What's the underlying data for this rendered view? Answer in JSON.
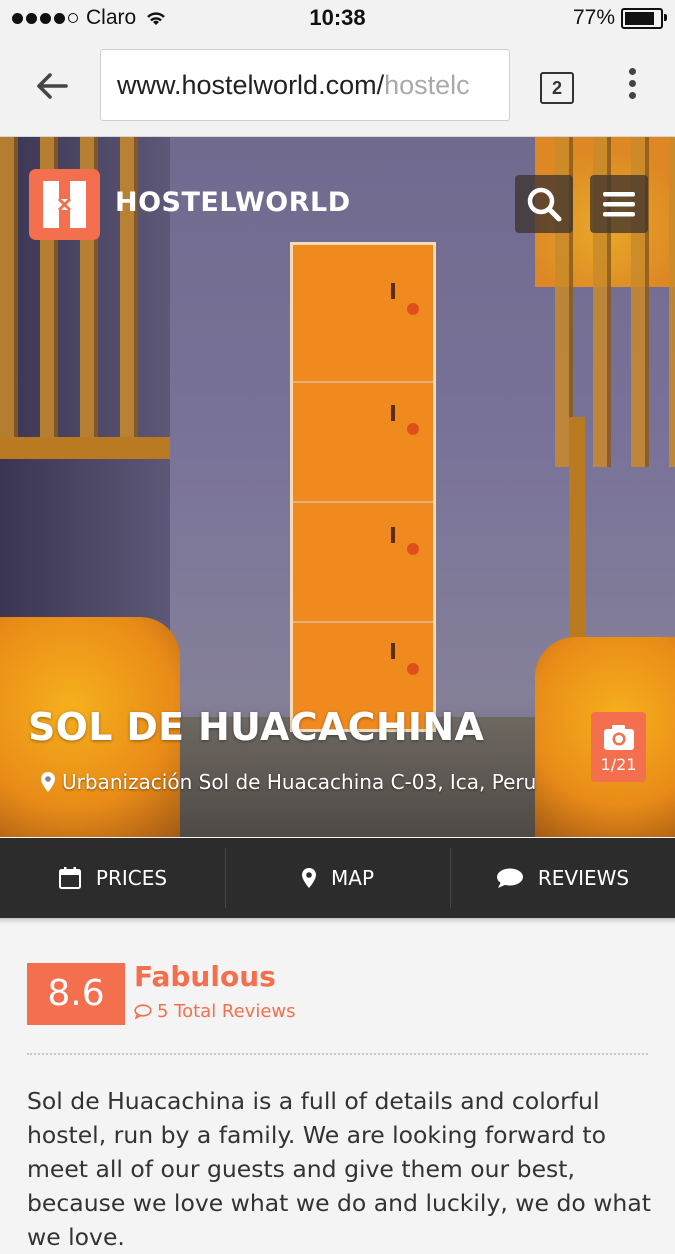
{
  "status_bar": {
    "carrier": "Claro",
    "time": "10:38",
    "battery": "77%"
  },
  "browser": {
    "url_main": "www.hostelworld.com/",
    "url_faded": "hostelc",
    "tab_count": "2"
  },
  "header": {
    "logo_text": "HOSTELWORLD"
  },
  "hero": {
    "title": "SOL DE HUACACHINA",
    "address": "Urbanización Sol de Huacachina C-03, Ica, Peru",
    "photo_counter": "1/21"
  },
  "nav": {
    "prices": "PRICES",
    "map": "MAP",
    "reviews": "REVIEWS"
  },
  "rating": {
    "score": "8.6",
    "label": "Fabulous",
    "reviews_link": "5 Total Reviews"
  },
  "description": "Sol de Huacachina is a full of details and colorful hostel, run by a family. We are looking forward to meet all of our guests and give them our best, because we love what we do and luckily, we do what we love.",
  "colors": {
    "brand": "#f46f4e",
    "nav_bg": "#2c2c2c",
    "page_bg": "#f4f4f4"
  },
  "icons": [
    "wifi-icon",
    "back-arrow-icon",
    "kebab-menu-icon",
    "hostelworld-logo-icon",
    "search-icon",
    "hamburger-menu-icon",
    "location-pin-icon",
    "camera-icon",
    "calendar-icon",
    "speech-bubble-icon"
  ]
}
